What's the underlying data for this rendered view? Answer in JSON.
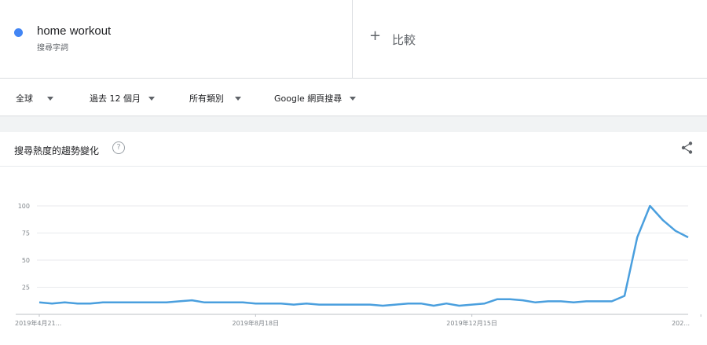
{
  "term": {
    "name": "home workout",
    "subtitle": "搜尋字詞",
    "color": "#4285f4"
  },
  "compare": {
    "icon": "plus-icon",
    "label": "比較"
  },
  "filters": {
    "region": "全球",
    "time": "過去 12 個月",
    "category": "所有類別",
    "search_type": "Google 網頁搜尋"
  },
  "card": {
    "title": "搜尋熱度的趨勢變化",
    "help_icon": "help-icon",
    "share_icon": "share-icon"
  },
  "chart_data": {
    "type": "line",
    "ylim": [
      0,
      100
    ],
    "y_ticks": [
      "25",
      "50",
      "75",
      "100"
    ],
    "x_tick_labels": [
      "2019年4月21...",
      "2019年8月18日",
      "2019年12月15日",
      "202..."
    ],
    "x_tick_label_indices": [
      0,
      17,
      34,
      52
    ],
    "grid": true,
    "series": [
      {
        "name": "home workout",
        "color": "#4a9fde",
        "values": [
          11,
          10,
          11,
          10,
          10,
          11,
          11,
          11,
          11,
          11,
          11,
          12,
          13,
          11,
          11,
          11,
          11,
          10,
          10,
          10,
          9,
          10,
          9,
          9,
          9,
          9,
          9,
          8,
          9,
          10,
          10,
          8,
          10,
          8,
          9,
          10,
          14,
          14,
          13,
          11,
          12,
          12,
          11,
          12,
          12,
          12,
          17,
          71,
          100,
          87,
          77,
          71
        ]
      }
    ]
  }
}
